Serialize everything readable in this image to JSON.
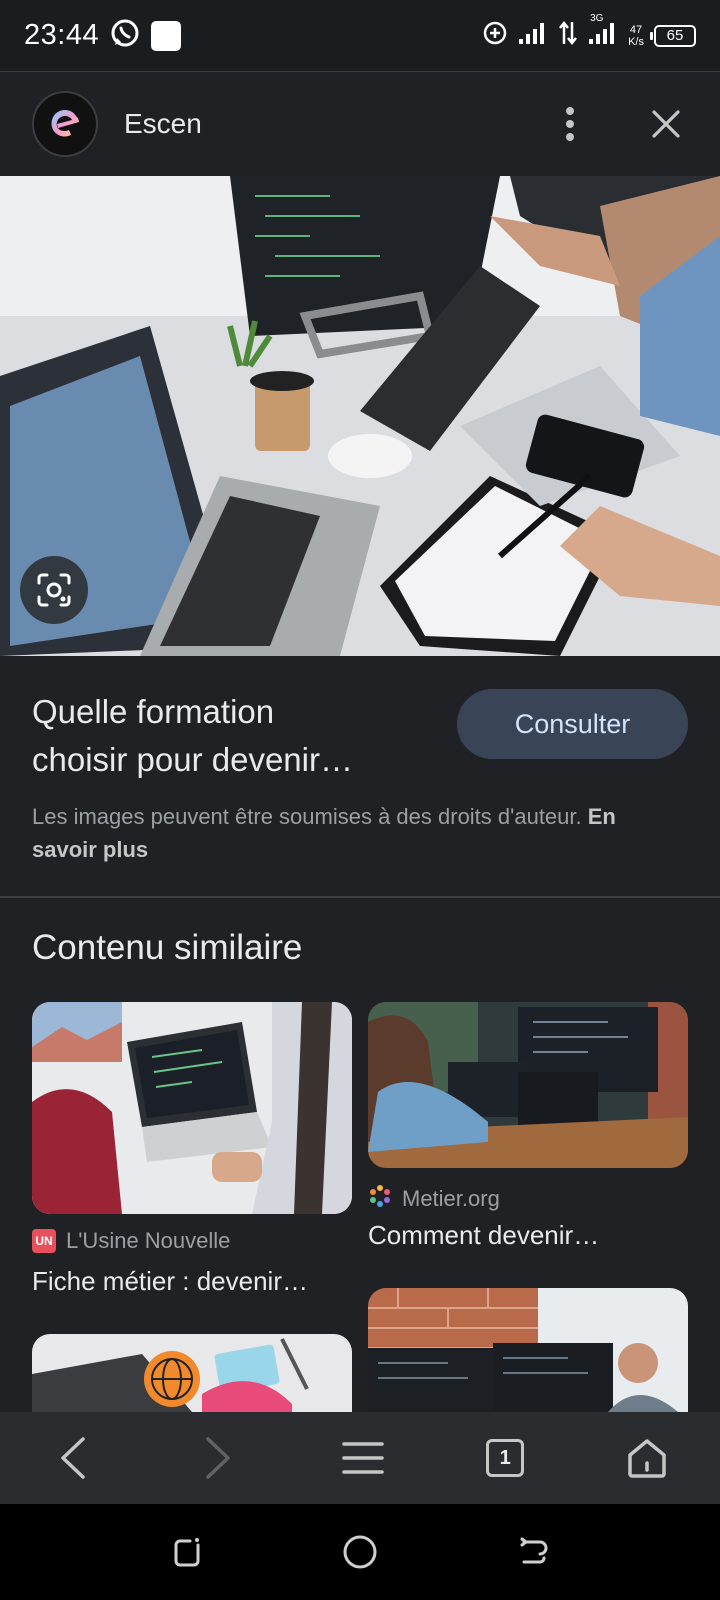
{
  "status_bar": {
    "time": "23:44",
    "network_speed_value": "47",
    "network_speed_unit": "K/s",
    "network_type": "3G",
    "battery": "65",
    "icons": [
      "whatsapp-icon",
      "notification-square-icon",
      "data-saver-icon",
      "signal-icon",
      "data-transfer-icon",
      "signal-3g-icon"
    ]
  },
  "header": {
    "title": "Escen",
    "more_icon": "more-vert-icon",
    "close_icon": "close-icon"
  },
  "hero": {
    "lens_icon": "google-lens-icon",
    "image_description_colors": [
      "#e9e9ea",
      "#2a2d31",
      "#6a8bb0"
    ]
  },
  "result": {
    "title_line1": "Quelle formation",
    "title_line2": "choisir pour devenir…",
    "button_label": "Consulter",
    "copyright_text": "Les images peuvent être soumises à des droits d'auteur. ",
    "learn_more": "En savoir plus"
  },
  "similar": {
    "heading": "Contenu similaire",
    "cards": [
      {
        "source": "L'Usine Nouvelle",
        "badge": "UN",
        "caption": "Fiche métier : devenir…"
      },
      {
        "source": "Metier.org",
        "caption": "Comment devenir…"
      }
    ]
  },
  "bottom_nav": {
    "tab_count": "1",
    "items": [
      "back-icon",
      "forward-icon",
      "menu-icon",
      "tabs-icon",
      "home-icon"
    ]
  },
  "system_nav": [
    "recents-icon",
    "home-circle-icon",
    "back-system-icon"
  ]
}
